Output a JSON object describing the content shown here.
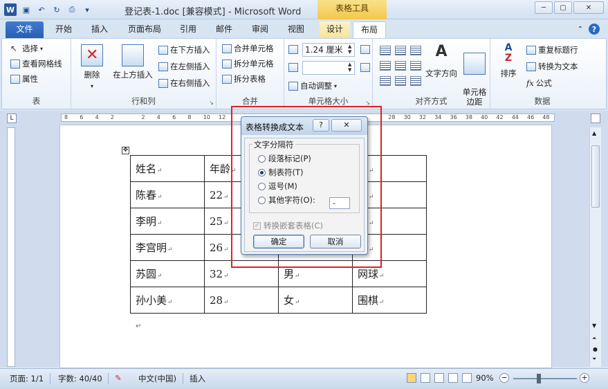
{
  "window": {
    "title": "登记表-1.doc [兼容模式] - Microsoft Word",
    "contextual_tab_header": "表格工具"
  },
  "tabs": [
    "文件",
    "开始",
    "插入",
    "页面布局",
    "引用",
    "邮件",
    "审阅",
    "视图",
    "设计",
    "布局"
  ],
  "ribbon": {
    "table_group": {
      "label": "表",
      "select": "选择",
      "view_gridlines": "查看网格线",
      "properties": "属性"
    },
    "rows_cols_group": {
      "label": "行和列",
      "delete": "删除",
      "insert_above": "在上方插入",
      "insert_below": "在下方插入",
      "insert_left": "在左侧插入",
      "insert_right": "在右侧插入"
    },
    "merge_group": {
      "label": "合并",
      "merge_cells": "合并单元格",
      "split_cells": "拆分单元格",
      "split_table": "拆分表格"
    },
    "cell_size_group": {
      "label": "单元格大小",
      "height_value": "1.24 厘米",
      "width_value": "",
      "autofit": "自动调整"
    },
    "alignment_group": {
      "label": "对齐方式",
      "text_direction": "文字方向",
      "cell_margins": "单元格\n边距"
    },
    "data_group": {
      "label": "数据",
      "sort": "排序",
      "repeat_header": "重复标题行",
      "convert_to_text": "转换为文本",
      "formula": "公式"
    }
  },
  "ruler": {
    "ticks": [
      "8",
      "6",
      "4",
      "2",
      "",
      "2",
      "4",
      "6",
      "8",
      "10",
      "12",
      "",
      "",
      "",
      "",
      "",
      "",
      "",
      "",
      "",
      "",
      "28",
      "30",
      "32",
      "34",
      "36",
      "38",
      "40",
      "42",
      "44",
      "46",
      "48"
    ]
  },
  "document": {
    "table": [
      [
        "姓名",
        "年龄",
        "",
        "好"
      ],
      [
        "陈春",
        "22",
        "",
        "书"
      ],
      [
        "李明",
        "25",
        "",
        "泳"
      ],
      [
        "李宫明",
        "26",
        "",
        "球"
      ],
      [
        "苏圆",
        "32",
        "男",
        "网球"
      ],
      [
        "孙小美",
        "28",
        "女",
        "围棋"
      ]
    ]
  },
  "dialog": {
    "title": "表格转换成文本",
    "help": "?",
    "separator_label": "文字分隔符",
    "options": [
      {
        "label": "段落标记(P)",
        "selected": false
      },
      {
        "label": "制表符(T)",
        "selected": true
      },
      {
        "label": "逗号(M)",
        "selected": false
      },
      {
        "label": "其他字符(O):",
        "selected": false
      }
    ],
    "other_char_value": "-",
    "nested_tables_label": "转换嵌套表格(C)",
    "ok": "确定",
    "cancel": "取消"
  },
  "status": {
    "page": "页面: 1/1",
    "words": "字数: 40/40",
    "language": "中文(中国)",
    "mode": "插入",
    "zoom": "90%"
  },
  "colors": {
    "file_tab": "#2a5fb0",
    "contextual_header": "#f3c74a",
    "highlight_box": "#e02020"
  }
}
